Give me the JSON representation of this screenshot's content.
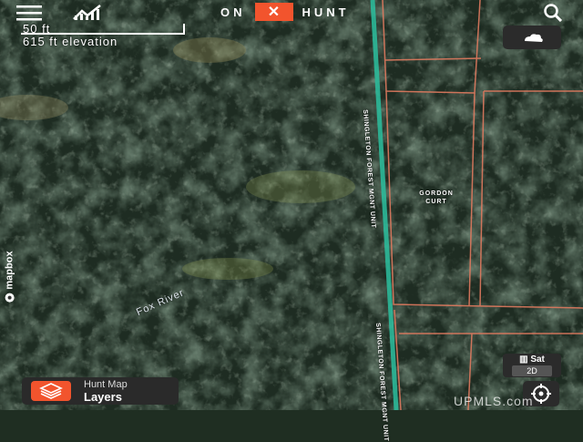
{
  "app": {
    "brand_left": "ON",
    "brand_right": "HUNT",
    "brand_accent": "#f2542d"
  },
  "topbar": {
    "menu_icon": "hamburger-menu-icon",
    "stats_icon": "chart-line-icon",
    "search_icon": "search-icon"
  },
  "scale": {
    "distance": "50 ft",
    "elevation": "615 ft elevation"
  },
  "map": {
    "parcel_label_line1": "GORDON",
    "parcel_label_line2": "CURT",
    "road_label_upper": "SHINGLETON FOREST MGNT UNIT",
    "road_label_lower": "SHINGLETON FOREST MGNT UNIT",
    "river_label": "Fox River",
    "attribution": "mapbox",
    "parcel_color": "#e07a5f",
    "road_color": "#2bbf9f"
  },
  "controls": {
    "layers_line1": "Hunt Map",
    "layers_line2": "Layers",
    "basemap_label": "Sat",
    "basemap_mode": "2D",
    "top_right_icon": "weather-cloud-icon",
    "bottom_right_icon": "gps-locate-icon"
  },
  "watermark": "UPMLS.com"
}
